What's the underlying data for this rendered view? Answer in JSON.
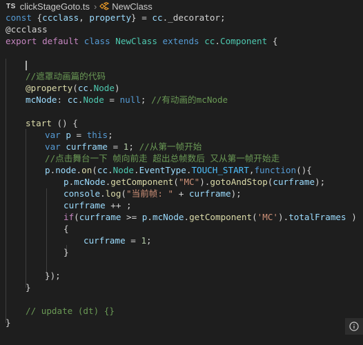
{
  "breadcrumb": {
    "lang_badge": "TS",
    "file": "clickStageGoto.ts",
    "separator": "›",
    "symbol": "NewClass"
  },
  "icons": {
    "symbol_class": "class-symbol-icon",
    "notification": "notification-icon"
  },
  "colors": {
    "background": "#1e1e1e",
    "keyword": "#569cd6",
    "control": "#c586c0",
    "variable": "#9cdcfe",
    "type": "#4ec9b0",
    "function": "#dcdcaa",
    "string": "#ce9178",
    "number": "#b5cea8",
    "comment": "#6a9955",
    "symbol_icon": "#ee9d28"
  },
  "code": {
    "l0": [
      "const",
      "{",
      "ccclass",
      ",",
      "property",
      "}",
      "=",
      "cc",
      "._decorator;"
    ],
    "l1": [
      "@ccclass"
    ],
    "l2": [
      "export",
      "default",
      "class",
      "NewClass",
      "extends",
      "cc",
      ".",
      "Component",
      "{"
    ],
    "l4": [
      "//遮罩动画篇的代码"
    ],
    "l5": [
      "@property",
      "(",
      "cc",
      ".",
      "Node",
      ")"
    ],
    "l6": [
      "mcNode",
      ":",
      "cc",
      ".",
      "Node",
      "=",
      "null",
      ";",
      "//有动画的mcNode"
    ],
    "l8": [
      "start",
      "() {"
    ],
    "l9": [
      "var",
      "p",
      "=",
      "this",
      ";"
    ],
    "l10": [
      "var",
      "curframe",
      "=",
      "1",
      ";",
      "//从第一帧开始"
    ],
    "l11": [
      "//点击舞台一下 帧向前走 超出总帧数后 又从第一帧开始走"
    ],
    "l12": [
      "p",
      ".",
      "node",
      ".",
      "on",
      "(",
      "cc",
      ".",
      "Node",
      ".",
      "EventType",
      ".",
      "TOUCH_START",
      ",",
      "function",
      "(){"
    ],
    "l13": [
      "p",
      ".",
      "mcNode",
      ".",
      "getComponent",
      "(",
      "\"MC\"",
      ").",
      "gotoAndStop",
      "(",
      "curframe",
      ");"
    ],
    "l14": [
      "console",
      ".",
      "log",
      "(",
      "\"当前帧: \"",
      "+",
      "curframe",
      ");"
    ],
    "l15": [
      "curframe",
      "++ ;"
    ],
    "l16": [
      "if",
      "(",
      "curframe",
      ">=",
      "p",
      ".",
      "mcNode",
      ".",
      "getComponent",
      "(",
      "'MC'",
      ").",
      "totalFrames",
      ")"
    ],
    "l17": [
      "{"
    ],
    "l18": [
      "curframe",
      "=",
      "1",
      ";"
    ],
    "l19": [
      "}"
    ],
    "l21": [
      "});"
    ],
    "l22": [
      "}"
    ],
    "l24": [
      "// update (dt) {}"
    ],
    "l25": [
      "}"
    ]
  }
}
